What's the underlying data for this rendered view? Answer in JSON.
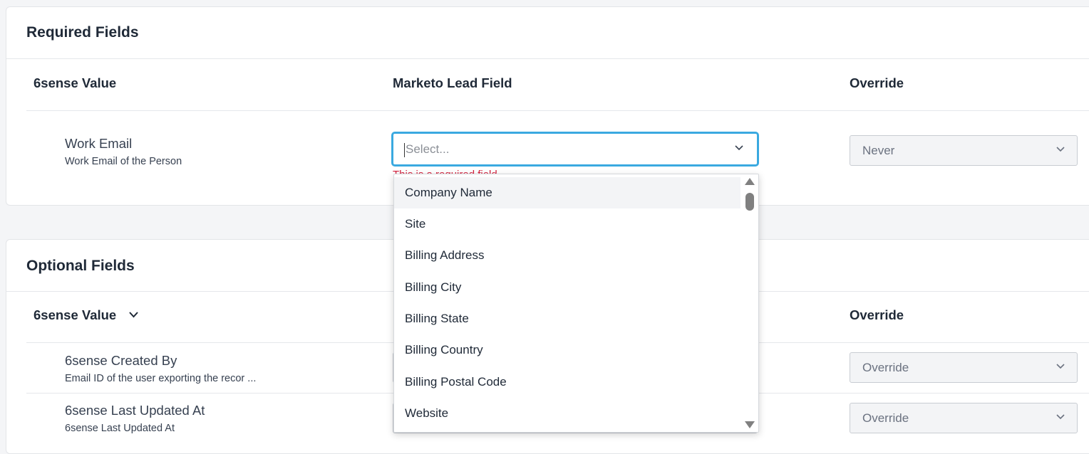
{
  "required": {
    "title": "Required Fields",
    "col_value": "6sense Value",
    "col_field": "Marketo Lead Field",
    "col_override": "Override",
    "row": {
      "title": "Work Email",
      "subtitle": "Work Email of the Person",
      "field_placeholder": "Select...",
      "error": "This is a required field",
      "override": "Never"
    }
  },
  "dropdown": {
    "options": [
      "Company Name",
      "Site",
      "Billing Address",
      "Billing City",
      "Billing State",
      "Billing Country",
      "Billing Postal Code",
      "Website"
    ],
    "highlighted": "Company Name"
  },
  "optional": {
    "title": "Optional Fields",
    "col_value": "6sense Value",
    "col_override": "Override",
    "rows": [
      {
        "title": "6sense Created By",
        "subtitle": "Email ID of the user exporting the recor ...",
        "override": "Override"
      },
      {
        "title": "6sense Last Updated At",
        "subtitle": "6sense Last Updated At",
        "override": "Override"
      }
    ]
  },
  "icons": {
    "chevron": "chevron-down-icon",
    "scroll_up": "arrow-up-icon",
    "scroll_down": "arrow-down-icon"
  },
  "colors": {
    "focus": "#3aa9e0",
    "error": "#d4213d"
  }
}
